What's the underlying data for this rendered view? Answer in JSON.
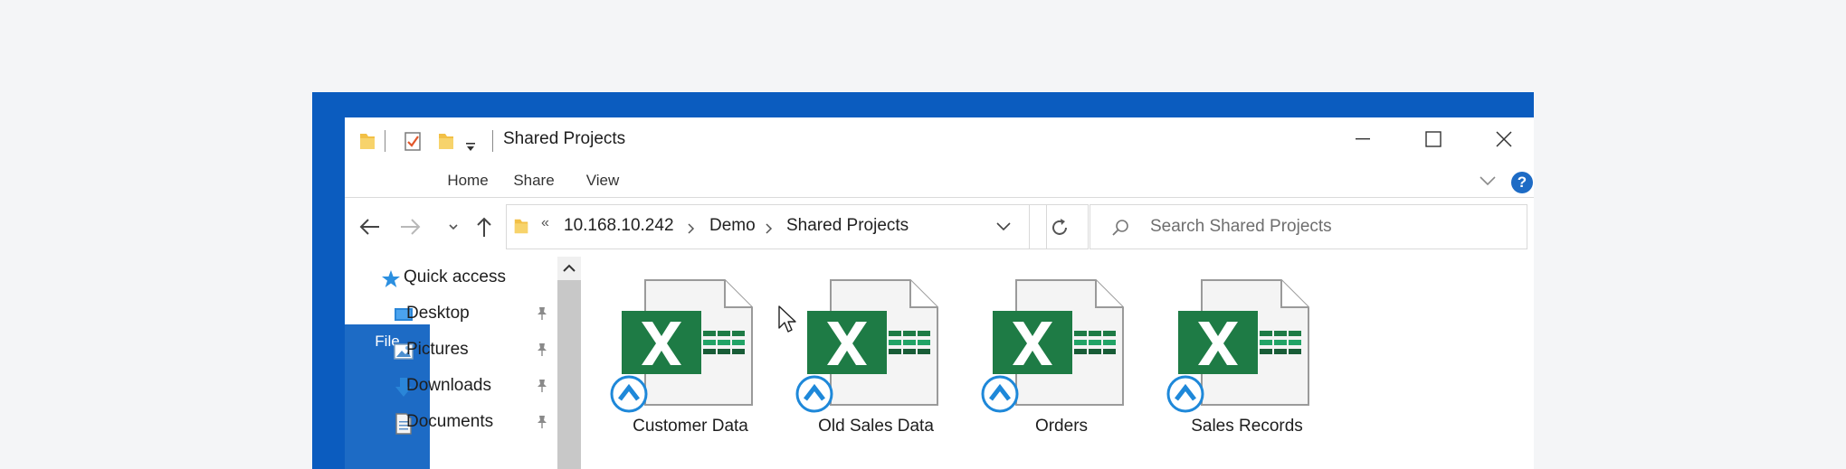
{
  "window": {
    "title": "Shared Projects"
  },
  "ribbon": {
    "tabs": [
      "File",
      "Home",
      "Share",
      "View"
    ],
    "help_label": "?"
  },
  "address": {
    "segments": [
      "10.168.10.242",
      "Demo",
      "Shared Projects"
    ],
    "overflow": "«"
  },
  "search": {
    "placeholder": "Search Shared Projects"
  },
  "nav": {
    "quick_access": "Quick access",
    "items": [
      {
        "label": "Desktop",
        "icon": "desktop-icon"
      },
      {
        "label": "Pictures",
        "icon": "pictures-icon"
      },
      {
        "label": "Downloads",
        "icon": "downloads-icon"
      },
      {
        "label": "Documents",
        "icon": "documents-icon"
      }
    ]
  },
  "files": [
    {
      "name": "Customer Data",
      "icon": "excel-file-icon"
    },
    {
      "name": "Old Sales Data",
      "icon": "excel-file-icon"
    },
    {
      "name": "Orders",
      "icon": "excel-file-icon"
    },
    {
      "name": "Sales Records",
      "icon": "excel-file-icon"
    }
  ],
  "colors": {
    "accent": "#1d6bc5",
    "desktop_bg": "#0b5cbf",
    "excel_green": "#1e7b45",
    "sync_badge": "#1e88d9"
  }
}
